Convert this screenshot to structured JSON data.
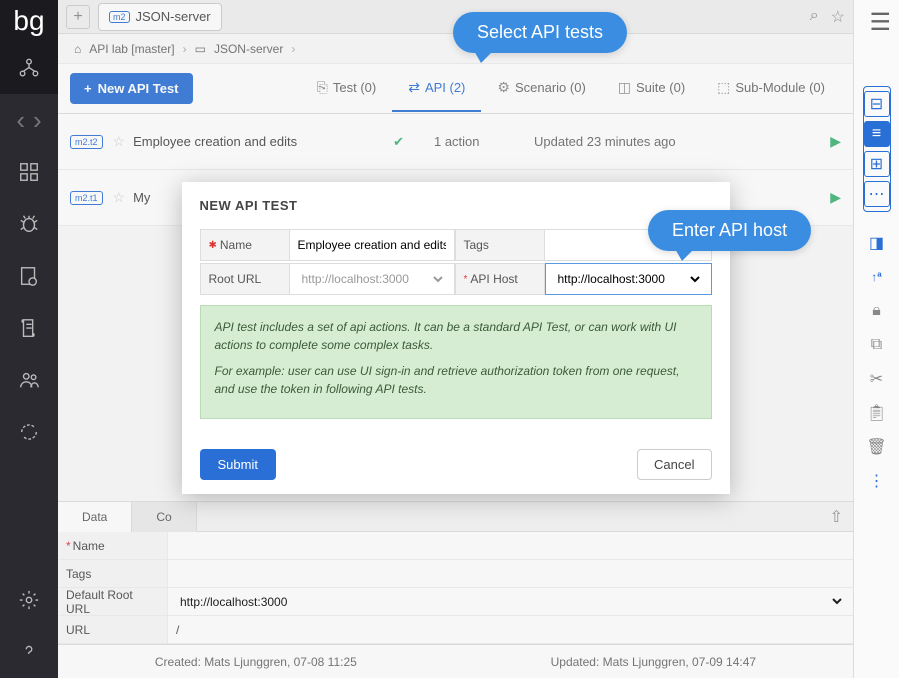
{
  "logo": "bg",
  "tabbar": {
    "tab_badge": "m2",
    "tab_label": "JSON-server"
  },
  "breadcrumb": {
    "home_icon": "⌂",
    "item1": "API lab [master]",
    "item2": "JSON-server"
  },
  "toolbar": {
    "new_api_label": "New API Test",
    "tabs": {
      "test": "Test (0)",
      "api": "API (2)",
      "scenario": "Scenario (0)",
      "suite": "Suite (0)",
      "submodule": "Sub-Module (0)"
    }
  },
  "list": {
    "rows": [
      {
        "badge": "m2.t2",
        "title": "Employee creation and edits",
        "actions": "1 action",
        "updated": "Updated 23 minutes ago",
        "check": true
      },
      {
        "badge": "m2.t1",
        "title": "My",
        "actions": "",
        "updated": "",
        "check": false
      }
    ]
  },
  "bottom": {
    "tabs": {
      "data": "Data",
      "co": "Co"
    },
    "fields": {
      "name_label": "Name",
      "tags_label": "Tags",
      "root_label": "Default Root URL",
      "root_value": "http://localhost:3000",
      "url_label": "URL",
      "url_value": "/"
    }
  },
  "modal": {
    "title": "NEW API TEST",
    "fields": {
      "name_label": "Name",
      "name_value": "Employee creation and edits",
      "tags_label": "Tags",
      "tags_value": "",
      "root_label": "Root URL",
      "root_placeholder": "http://localhost:3000",
      "host_label": "API Host",
      "host_value": "http://localhost:3000"
    },
    "info_p1": "API test includes a set of api actions. It can be a standard API Test, or can work with UI actions to complete some complex tasks.",
    "info_p2": "For example: user can use UI sign-in and retrieve authorization token from one request, and use the token in following API tests.",
    "submit": "Submit",
    "cancel": "Cancel"
  },
  "callouts": {
    "c1": "Select API tests",
    "c2": "Enter API host"
  },
  "status": {
    "created": "Created: Mats Ljunggren, 07-08 11:25",
    "updated": "Updated: Mats Ljunggren, 07-09 14:47"
  }
}
